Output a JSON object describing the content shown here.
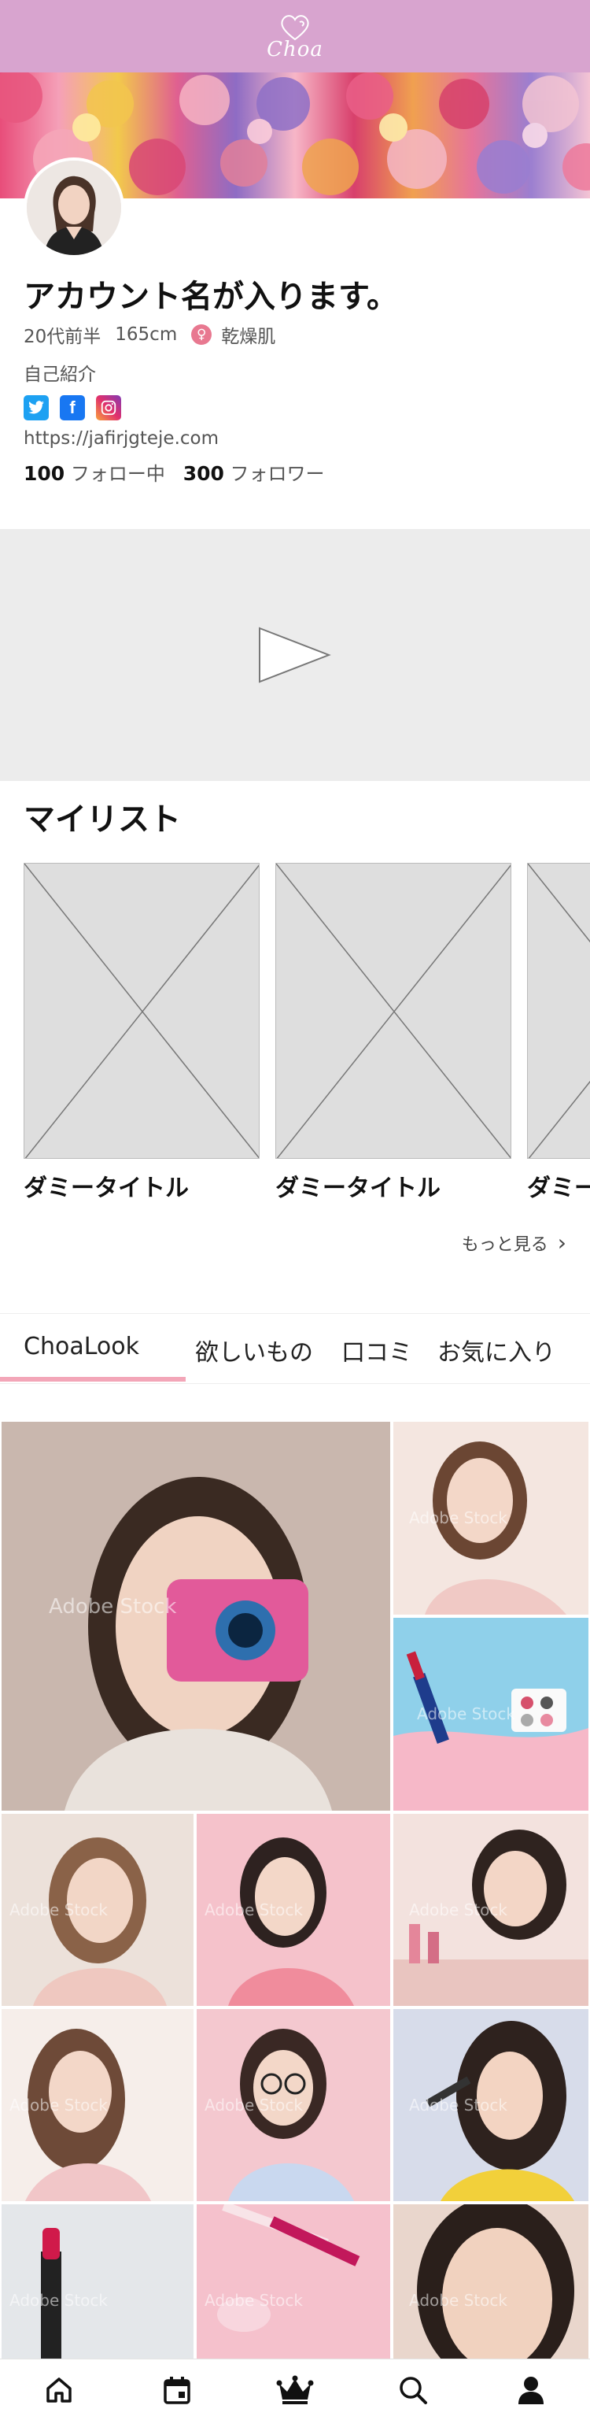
{
  "header": {
    "logo_text": "Choa",
    "color": "#d8a4cf"
  },
  "profile": {
    "account_name": "アカウント名が入ります。",
    "age": "20代前半",
    "height": "165cm",
    "skin_type": "乾燥肌",
    "intro": "自己紹介",
    "url": "https://jafirjgteje.com",
    "following_count": "100",
    "following_label": "フォロー中",
    "followers_count": "300",
    "followers_label": "フォロワー",
    "socials": [
      "twitter-icon",
      "facebook-icon",
      "instagram-icon"
    ]
  },
  "mylist": {
    "title": "マイリスト",
    "items": [
      {
        "title": "ダミータイトル"
      },
      {
        "title": "ダミータイトル"
      },
      {
        "title": "ダミータイトル"
      }
    ],
    "more_label": "もっと見る"
  },
  "tabs": [
    {
      "label": "ChoaLook",
      "active": true
    },
    {
      "label": "欲しいもの",
      "active": false
    },
    {
      "label": "口コミ",
      "active": false
    },
    {
      "label": "お気に入り",
      "active": false
    }
  ],
  "grid": {
    "watermark": "Adobe Stock",
    "photos": [
      {
        "subject": "woman-with-camera-photo",
        "color": "#c9b7ae"
      },
      {
        "subject": "woman-smiling-photo",
        "color": "#f2e2dc"
      },
      {
        "subject": "lipstick-cosmetics-photo",
        "color": "#8fd0ea"
      },
      {
        "subject": "woman-portrait-photo",
        "color": "#e8d8cf"
      },
      {
        "subject": "woman-pink-background-photo",
        "color": "#f3c6cc"
      },
      {
        "subject": "woman-cosmetics-table-photo",
        "color": "#f1dcd8"
      },
      {
        "subject": "woman-long-hair-photo",
        "color": "#f2d4d4"
      },
      {
        "subject": "woman-glasses-photo",
        "color": "#f2c9cf"
      },
      {
        "subject": "woman-makeup-brush-photo",
        "color": "#d9dce9"
      },
      {
        "subject": "lipstick-closeup-photo",
        "color": "#dfe3e7"
      },
      {
        "subject": "makeup-brushes-pink-photo",
        "color": "#f4c3cf"
      },
      {
        "subject": "woman-face-closeup-photo",
        "color": "#e4cbbd"
      }
    ]
  },
  "bottom_nav": [
    "home-icon",
    "calendar-icon",
    "crown-icon",
    "search-icon",
    "profile-icon"
  ]
}
